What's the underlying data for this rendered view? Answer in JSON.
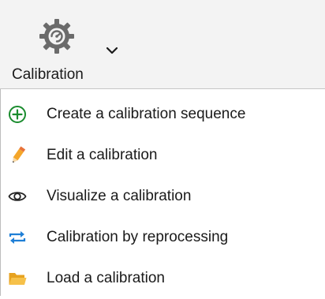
{
  "ribbon": {
    "calibration_button": {
      "label": "Calibration",
      "icon": "gear-icon",
      "dropdown_icon": "chevron-down-icon"
    }
  },
  "menu": {
    "items": [
      {
        "label": "Create a calibration sequence",
        "icon": "add-circle-icon",
        "icon_color": "#1a8c2e"
      },
      {
        "label": "Edit a calibration",
        "icon": "pencil-icon",
        "icon_color": "#f4a62a"
      },
      {
        "label": "Visualize a calibration",
        "icon": "eye-icon",
        "icon_color": "#222222"
      },
      {
        "label": "Calibration by reprocessing",
        "icon": "repeat-icon",
        "icon_color": "#1f7fd6"
      },
      {
        "label": "Load a calibration",
        "icon": "folder-icon",
        "icon_color": "#f2b12e"
      }
    ]
  }
}
